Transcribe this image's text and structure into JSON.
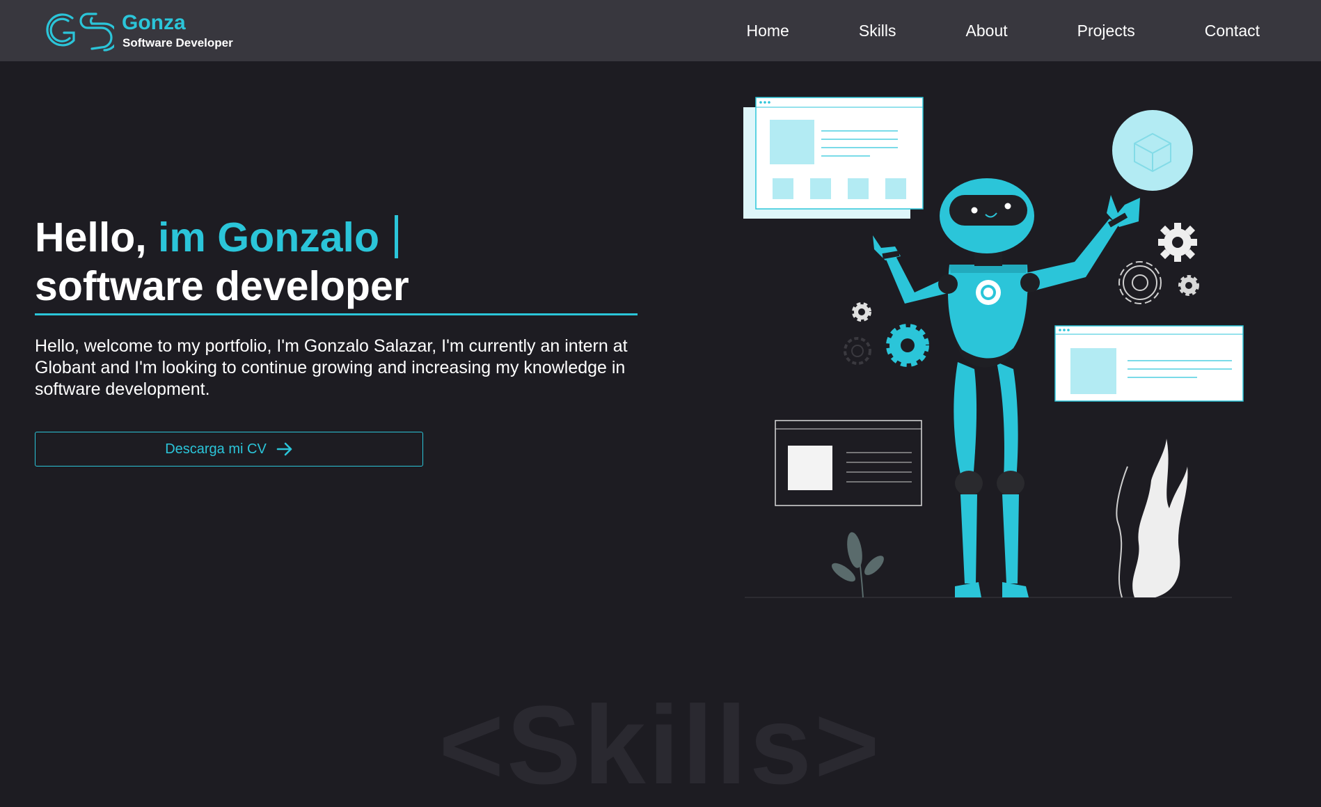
{
  "colors": {
    "accent": "#2bc5d9",
    "background": "#1d1c22",
    "navbar": "#38373e"
  },
  "brand": {
    "logo_icon": "gs-monogram-logo",
    "name": "Gonza",
    "subtitle": "Software Developer"
  },
  "nav": {
    "items": [
      {
        "label": "Home"
      },
      {
        "label": "Skills"
      },
      {
        "label": "About"
      },
      {
        "label": "Projects"
      },
      {
        "label": "Contact"
      }
    ]
  },
  "hero": {
    "greeting": "Hello, ",
    "name_highlight": "im Gonzalo",
    "role": "software developer",
    "description": "Hello, welcome to my portfolio, I'm Gonzalo Salazar, I'm currently an intern at Globant and I'm looking to continue growing and increasing my knowledge in software development.",
    "cv_button_label": "Descarga mi CV",
    "cv_button_icon": "arrow-right-icon",
    "illustration": "robot-with-ui-cards-illustration"
  },
  "next_section": {
    "watermark": "<Skills>"
  }
}
